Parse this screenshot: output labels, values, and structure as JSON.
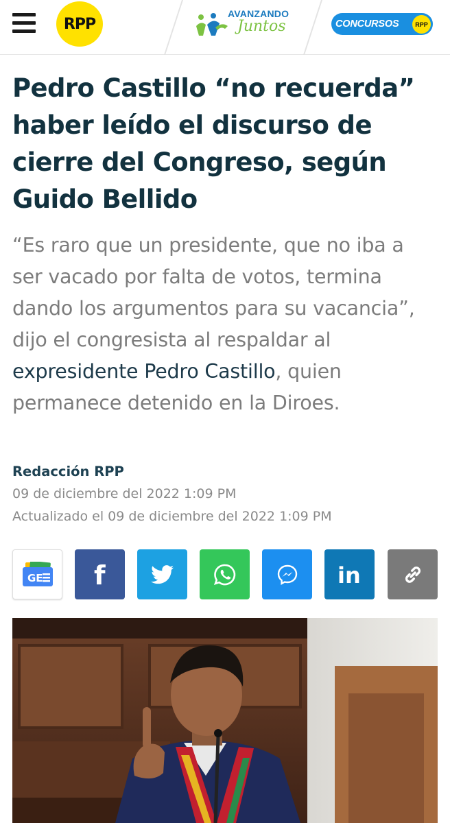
{
  "header": {
    "logo_text": "RPP",
    "campaign_title": "AVANZANDO",
    "campaign_subtitle": "Juntos",
    "concursos_label": "CONCURSOS",
    "concursos_badge": "RPP",
    "icons": [
      "menu-icon",
      "rpp-logo",
      "avanzando-juntos-logo"
    ],
    "colors": {
      "rpp_yellow": "#ffe100",
      "concursos_blue": "#1a8fe0",
      "campaign_green": "#7cc242",
      "campaign_blue": "#1c7bbf"
    }
  },
  "article": {
    "headline": "Pedro Castillo “no recuerda” haber leído el discurso de cierre del Congreso, según Guido Bellido",
    "summary_before": "“Es raro que un presidente, que no iba a ser vacado por falta de votos, termina dando los argumentos para su vacancia”, dijo el congresista al respaldar al ",
    "summary_link": "expresidente Pedro Castillo",
    "summary_after": ", quien permanece detenido en la Diroes.",
    "author": "Redacción RPP",
    "published": "09 de diciembre del 2022 1:09 PM",
    "updated": "Actualizado el 09 de diciembre del 2022 1:09 PM",
    "photo_icon": "speaker-at-congress-photo"
  },
  "share": {
    "google_news_label": "GE",
    "facebook_label": "f",
    "linkedin_label": "in",
    "icons": [
      "google-news-icon",
      "facebook-icon",
      "twitter-icon",
      "whatsapp-icon",
      "messenger-icon",
      "linkedin-icon",
      "link-icon"
    ],
    "colors": {
      "facebook": "#3a5899",
      "twitter": "#1da1e2",
      "whatsapp": "#34c75a",
      "messenger": "#1c8ff0",
      "linkedin": "#0f78b5",
      "copy": "#7a7a7a"
    }
  }
}
